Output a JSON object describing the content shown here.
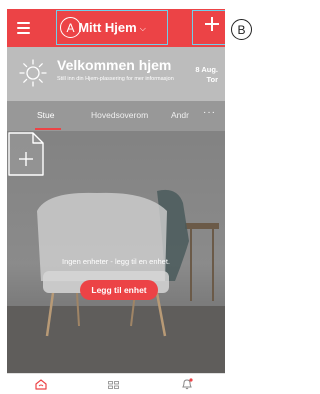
{
  "topbar": {
    "home_title": "Mitt Hjem",
    "chevron": "⌵",
    "callout_a": "A"
  },
  "callout_b": "B",
  "banner": {
    "welcome": "Velkommen hjem",
    "subtitle": "Still inn din Hjem-plassering for mer informasjon",
    "date_line1": "8 Aug.",
    "date_line2": "Tor"
  },
  "tabs": [
    {
      "label": "Stue"
    },
    {
      "label": "Hovedsoverom"
    },
    {
      "label": "Andr"
    }
  ],
  "more": "···",
  "empty": {
    "message": "Ingen enheter - legg til en enhet.",
    "button": "Legg til enhet"
  },
  "colors": {
    "accent": "#ec4346",
    "callout_outline": "#6fd0ea"
  },
  "icons": {
    "menu": "hamburger-icon",
    "add": "plus-icon",
    "weather": "sun-icon",
    "more": "ellipsis-icon",
    "home": "home-icon",
    "grid": "grid-icon",
    "notifications": "bell-icon"
  }
}
